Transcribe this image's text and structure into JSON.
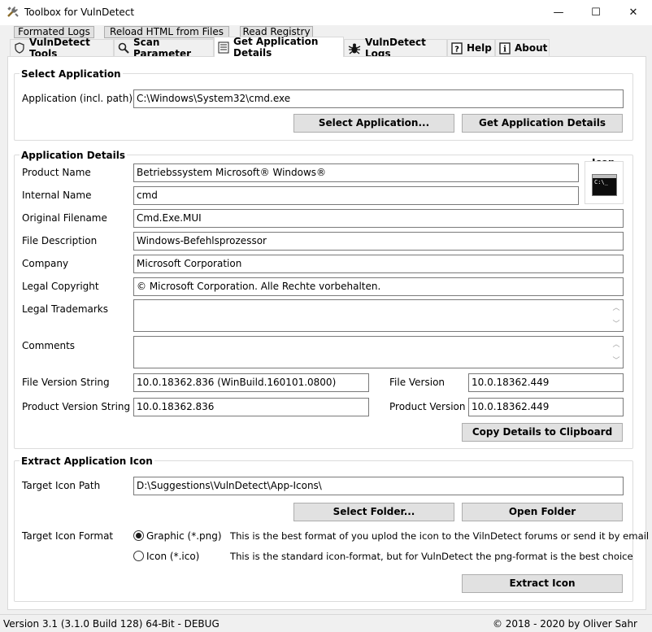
{
  "window": {
    "title": "Toolbox for VulnDetect",
    "minimize": "—",
    "maximize": "☐",
    "close": "✕"
  },
  "subtabs": [
    "Formated Logs",
    "Reload HTML from Files",
    "Read Registry"
  ],
  "tabs": [
    "VulnDetect Tools",
    "Scan Parameter",
    "Get Application Details",
    "VulnDetect Logs",
    "Help",
    "About"
  ],
  "select_app": {
    "title": "Select Application",
    "label": "Application (incl. path)",
    "value": "C:\\Windows\\System32\\cmd.exe",
    "select_button": "Select Application...",
    "get_button": "Get Application Details"
  },
  "details": {
    "title": "Application Details",
    "icon_label": "Icon",
    "icon_text": "C:\\_",
    "product_name_label": "Product Name",
    "product_name": "Betriebssystem Microsoft® Windows®",
    "internal_name_label": "Internal Name",
    "internal_name": "cmd",
    "original_filename_label": "Original Filename",
    "original_filename": "Cmd.Exe.MUI",
    "file_description_label": "File Description",
    "file_description": "Windows-Befehlsprozessor",
    "company_label": "Company",
    "company": "Microsoft Corporation",
    "legal_copyright_label": "Legal Copyright",
    "legal_copyright": "© Microsoft Corporation. Alle Rechte vorbehalten.",
    "legal_trademarks_label": "Legal Trademarks",
    "legal_trademarks": "",
    "comments_label": "Comments",
    "comments": "",
    "file_version_string_label": "File Version String",
    "file_version_string": "10.0.18362.836 (WinBuild.160101.0800)",
    "file_version_label": "File Version",
    "file_version": "10.0.18362.449",
    "product_version_string_label": "Product Version String",
    "product_version_string": "10.0.18362.836",
    "product_version_label": "Product Version",
    "product_version": "10.0.18362.449",
    "copy_button": "Copy Details to Clipboard"
  },
  "extract": {
    "title": "Extract Application Icon",
    "target_path_label": "Target Icon Path",
    "target_path": "D:\\Suggestions\\VulnDetect\\App-Icons\\",
    "select_folder_button": "Select Folder...",
    "open_folder_button": "Open Folder",
    "format_label": "Target Icon Format",
    "option_png": "Graphic (*.png)",
    "option_png_desc": "This is the best format of you uplod the icon to the VilnDetect forums or send it by email",
    "option_ico": "Icon (*.ico)",
    "option_ico_desc": "This is the standard icon-format, but for VulnDetect the png-format is the best choice",
    "selected_format": "png",
    "extract_button": "Extract Icon"
  },
  "status": {
    "version": "Version 3.1 (3.1.0 Build 128) 64-Bit - DEBUG",
    "copyright": "© 2018 - 2020 by Oliver Sahr"
  }
}
